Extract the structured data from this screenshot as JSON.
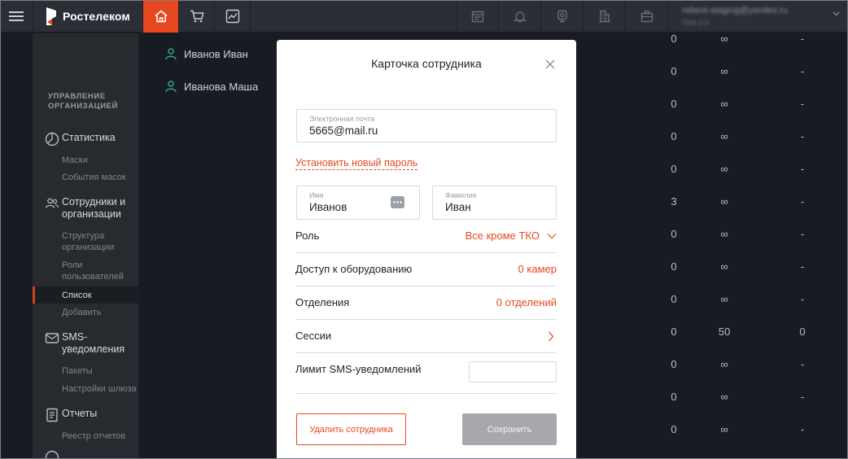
{
  "brand": {
    "name": "Ростелеком",
    "accent": "#e8481f"
  },
  "topbar": {
    "nav": [
      {
        "icon": "home-icon",
        "active": true
      },
      {
        "icon": "cart-icon",
        "active": false
      },
      {
        "icon": "chart-icon",
        "active": false
      }
    ],
    "tools": [
      "calendar-icon",
      "bell-icon",
      "camera-icon",
      "building-icon",
      "briefcase-icon"
    ],
    "account": {
      "email": "rebeot-staging@yandex.ru",
      "sub": "ПАК 2.0"
    }
  },
  "sidebar": {
    "section_title": "Управление организацией",
    "groups": [
      {
        "label": "Статистика",
        "icon": "stats-icon",
        "items": [
          "Маски",
          "События масок"
        ]
      },
      {
        "label": "Сотрудники и организации",
        "icon": "people-icon",
        "items": [
          "Структура организации",
          "Роли пользователей",
          "Список",
          "Добавить"
        ],
        "active_item": "Список"
      },
      {
        "label": "SMS-уведомления",
        "icon": "sms-icon",
        "items": [
          "Пакеты",
          "Настройки шлюза"
        ]
      },
      {
        "label": "Отчеты",
        "icon": "report-icon",
        "items": [
          "Реестр отчетов"
        ]
      }
    ]
  },
  "employees": [
    "Иванов Иван",
    "Иванова Маша"
  ],
  "table": {
    "rows": [
      [
        "0",
        "∞",
        "-"
      ],
      [
        "0",
        "∞",
        "-"
      ],
      [
        "0",
        "∞",
        "-"
      ],
      [
        "0",
        "∞",
        "-"
      ],
      [
        "0",
        "∞",
        "-"
      ],
      [
        "3",
        "∞",
        "-"
      ],
      [
        "0",
        "∞",
        "-"
      ],
      [
        "0",
        "∞",
        "-"
      ],
      [
        "0",
        "∞",
        "-"
      ],
      [
        "0",
        "50",
        "0"
      ],
      [
        "0",
        "∞",
        "-"
      ],
      [
        "0",
        "∞",
        "-"
      ],
      [
        "0",
        "∞",
        "-"
      ]
    ]
  },
  "modal": {
    "title": "Карточка сотрудника",
    "email": {
      "label": "Электронная почта",
      "value": "5665@mail.ru"
    },
    "reset_password": "Установить новый пароль",
    "first_name": {
      "label": "Имя",
      "value": "Иванов"
    },
    "last_name": {
      "label": "Фамилия",
      "value": "Иван"
    },
    "role": {
      "label": "Роль",
      "value": "Все кроме ТКО"
    },
    "equipment": {
      "label": "Доступ к оборудованию",
      "value": "0 камер"
    },
    "departments": {
      "label": "Отделения",
      "value": "0 отделений"
    },
    "sessions": {
      "label": "Сессии"
    },
    "sms_limit": {
      "label": "Лимит SMS-уведомлений",
      "value": ""
    },
    "delete_button": "Удалить сотрудника",
    "save_button": "Сохранить"
  }
}
